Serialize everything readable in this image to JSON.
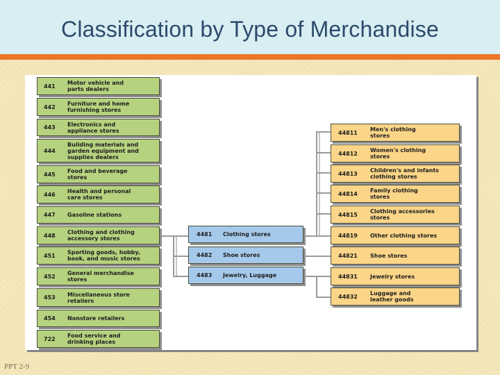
{
  "slide": {
    "title": "Classification by Type of Merchandise",
    "footer": "PPT 2-9"
  },
  "colors": {
    "header_bg": "#d8eef3",
    "title_text": "#2c4a6b",
    "accent_bar": "#ee7428",
    "level1_box": "#b5d27f",
    "level2_box": "#a5c9ea",
    "level3_box": "#fbd588"
  },
  "diagram": {
    "level1": [
      {
        "code": "441",
        "label": "Motor vehicle and\nparts dealers"
      },
      {
        "code": "442",
        "label": "Furniture and home\nfurnishing stores"
      },
      {
        "code": "443",
        "label": "Electronics and\nappliance stores"
      },
      {
        "code": "444",
        "label": "Building materials and\ngarden equipment and\nsupplies dealers"
      },
      {
        "code": "445",
        "label": "Food and beverage\nstores"
      },
      {
        "code": "446",
        "label": "Health and personal\ncare stores"
      },
      {
        "code": "447",
        "label": "Gasoline stations"
      },
      {
        "code": "448",
        "label": "Clothing and clothing\naccessory stores"
      },
      {
        "code": "451",
        "label": "Sporting goods, hobby,\nbook, and music stores"
      },
      {
        "code": "452",
        "label": "General merchandise\nstores"
      },
      {
        "code": "453",
        "label": "Miscellaneous store\nretailers"
      },
      {
        "code": "454",
        "label": "Nonstore retailers"
      },
      {
        "code": "722",
        "label": "Food service and\ndrinking places"
      }
    ],
    "level2": [
      {
        "code": "4481",
        "label": "Clothing stores"
      },
      {
        "code": "4482",
        "label": "Shoe stores"
      },
      {
        "code": "4483",
        "label": "Jewelry, Luggage"
      }
    ],
    "level3": [
      {
        "code": "44811",
        "label": "Men's clothing\nstores"
      },
      {
        "code": "44812",
        "label": "Women's clothing\nstores"
      },
      {
        "code": "44813",
        "label": "Children's and infants\nclothing stores"
      },
      {
        "code": "44814",
        "label": "Family clothing\nstores"
      },
      {
        "code": "44815",
        "label": "Clothing accessories\nstores"
      },
      {
        "code": "44819",
        "label": "Other clothing stores"
      },
      {
        "code": "44821",
        "label": "Shoe stores"
      },
      {
        "code": "44831",
        "label": "Jewelry stores"
      },
      {
        "code": "44832",
        "label": "Luggage and\nleather goods"
      }
    ]
  }
}
